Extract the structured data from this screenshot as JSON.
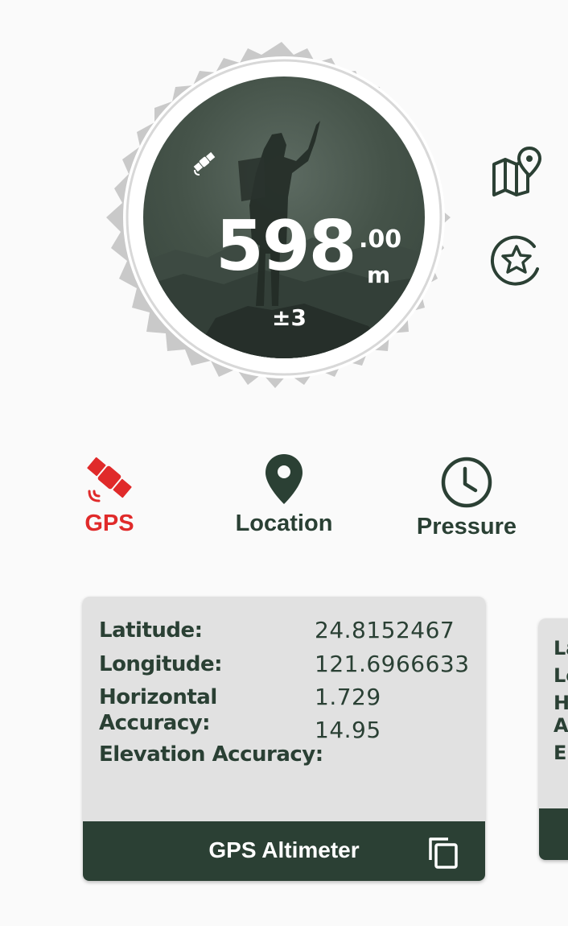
{
  "altitude": {
    "value": "598",
    "decimal": ".00",
    "unit": "m",
    "accuracy": "±3"
  },
  "tabs": [
    {
      "label": "GPS",
      "icon": "satellite-icon",
      "active": true,
      "color": "#e02a2a"
    },
    {
      "label": "Location",
      "icon": "location-pin-icon",
      "active": false
    },
    {
      "label": "Pressure",
      "icon": "clock-icon",
      "active": false
    }
  ],
  "card": {
    "labels": {
      "latitude": "Latitude:",
      "longitude": "Longitude:",
      "horizontal": "Horizontal Accuracy:",
      "elevation": "Elevation Accuracy:"
    },
    "values": {
      "latitude": "24.8152467",
      "longitude": "121.6966633",
      "horizontal": "1.729",
      "elevation": "14.95"
    },
    "footer_title": "GPS Altimeter"
  },
  "card2": {
    "peek_letters": [
      "La",
      "Lo",
      "H",
      "A",
      "El"
    ]
  },
  "colors": {
    "primary": "#2b4034",
    "accent_red": "#e02a2a",
    "card_bg": "#e1e1e1",
    "page_bg": "#fafafa"
  },
  "side_icons": [
    "map-pin-icon",
    "star-circle-icon"
  ]
}
